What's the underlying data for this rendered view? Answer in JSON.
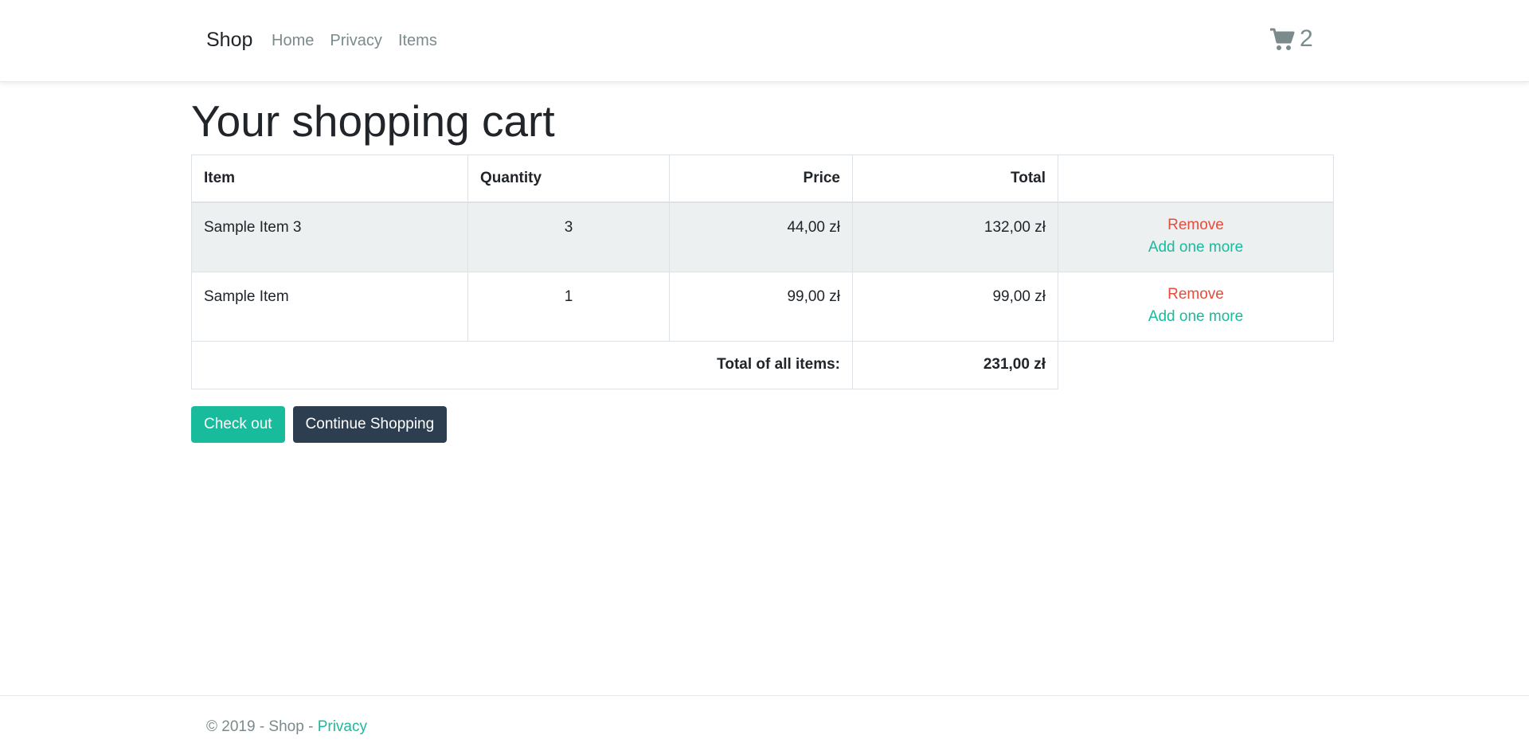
{
  "navbar": {
    "brand": "Shop",
    "links": [
      "Home",
      "Privacy",
      "Items"
    ],
    "cart_count": "2"
  },
  "main": {
    "title": "Your shopping cart",
    "table": {
      "headers": [
        "Item",
        "Quantity",
        "Price",
        "Total",
        ""
      ],
      "rows": [
        {
          "item": "Sample Item 3",
          "quantity": "3",
          "price": "44,00 zł",
          "total": "132,00 zł",
          "remove_label": "Remove",
          "add_label": "Add one more"
        },
        {
          "item": "Sample Item",
          "quantity": "1",
          "price": "99,00 zł",
          "total": "99,00 zł",
          "remove_label": "Remove",
          "add_label": "Add one more"
        }
      ],
      "summary_label": "Total of all items:",
      "summary_total": "231,00 zł"
    },
    "buttons": {
      "checkout": "Check out",
      "continue": "Continue Shopping"
    }
  },
  "footer": {
    "text": "© 2019 - Shop - ",
    "privacy_link": "Privacy"
  },
  "colors": {
    "success": "#18bc9c",
    "danger": "#e74c3c",
    "dark": "#2c3e50",
    "muted": "#7b8a8b",
    "stripe": "#ecf0f1"
  }
}
